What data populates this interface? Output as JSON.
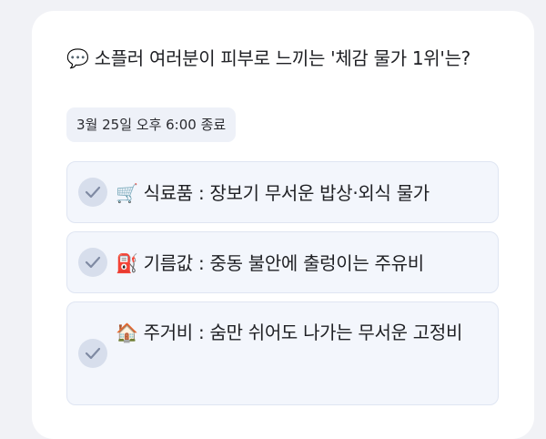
{
  "poll": {
    "question_icon": "speech-bubble-icon",
    "question_emoji": "💬",
    "question": "소플러 여러분이 피부로 느끼는 '체감 물가 1위'는?",
    "deadline": "3월 25일 오후 6:00 종료",
    "options": [
      {
        "emoji": "🛒",
        "icon": "shopping-cart-icon",
        "label": "식료품 : 장보기 무서운 밥상·외식 물가"
      },
      {
        "emoji": "⛽",
        "icon": "fuel-pump-icon",
        "label": "기름값 : 중동 불안에 출렁이는 주유비"
      },
      {
        "emoji": "🏠",
        "icon": "house-icon",
        "label": "주거비 : 숨만 쉬어도 나가는 무서운 고정비"
      }
    ]
  }
}
